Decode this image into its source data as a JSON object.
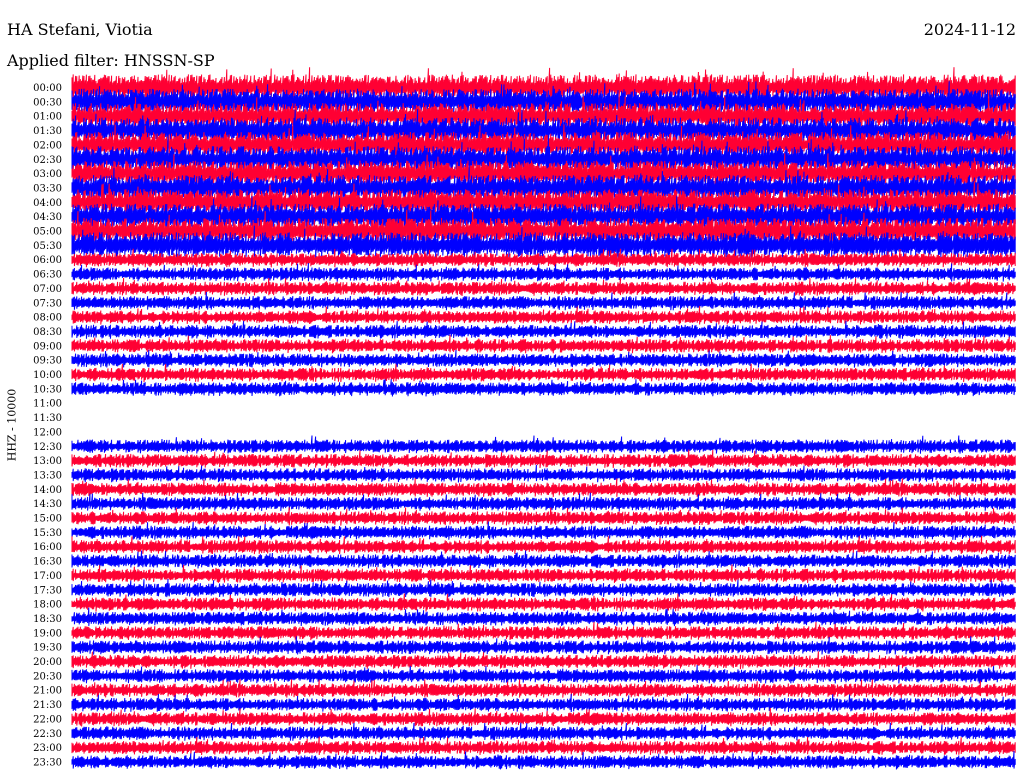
{
  "header": {
    "station": "HA Stefani, Viotia",
    "filter": "Applied filter: HNSSN-SP",
    "date": "2024-11-12",
    "channel": "HHZ - 10000"
  },
  "colors": {
    "trace_a": "#ff0033",
    "trace_b": "#0000ff",
    "background": "#ffffff",
    "text": "#000000"
  },
  "chart_data": {
    "type": "helicorder",
    "title": "HA Stefani, Viotia",
    "subtitle": "Applied filter: HNSSN-SP",
    "ylabel": "HHZ - 10000",
    "date": "2024-11-12",
    "row_labels": [
      "00:00",
      "00:30",
      "01:00",
      "01:30",
      "02:00",
      "02:30",
      "03:00",
      "03:30",
      "04:00",
      "04:30",
      "05:00",
      "05:30",
      "06:00",
      "06:30",
      "07:00",
      "07:30",
      "08:00",
      "08:30",
      "09:00",
      "09:30",
      "10:00",
      "10:30",
      "11:00",
      "11:30",
      "12:00",
      "12:30",
      "13:00",
      "13:30",
      "14:00",
      "14:30",
      "15:00",
      "15:30",
      "16:00",
      "16:30",
      "17:00",
      "17:30",
      "18:00",
      "18:30",
      "19:00",
      "19:30",
      "20:00",
      "20:30",
      "21:00",
      "21:30",
      "22:00",
      "22:30",
      "23:00",
      "23:30"
    ],
    "row_minutes": 30,
    "series": [
      {
        "color": "#ff0033",
        "rows": "even"
      },
      {
        "color": "#0000ff",
        "rows": "odd"
      }
    ],
    "data_gap": {
      "start": "11:00",
      "end": "12:30"
    },
    "noise_level": {
      "high_until": "06:00",
      "high": 0.95,
      "low": 0.5
    }
  }
}
